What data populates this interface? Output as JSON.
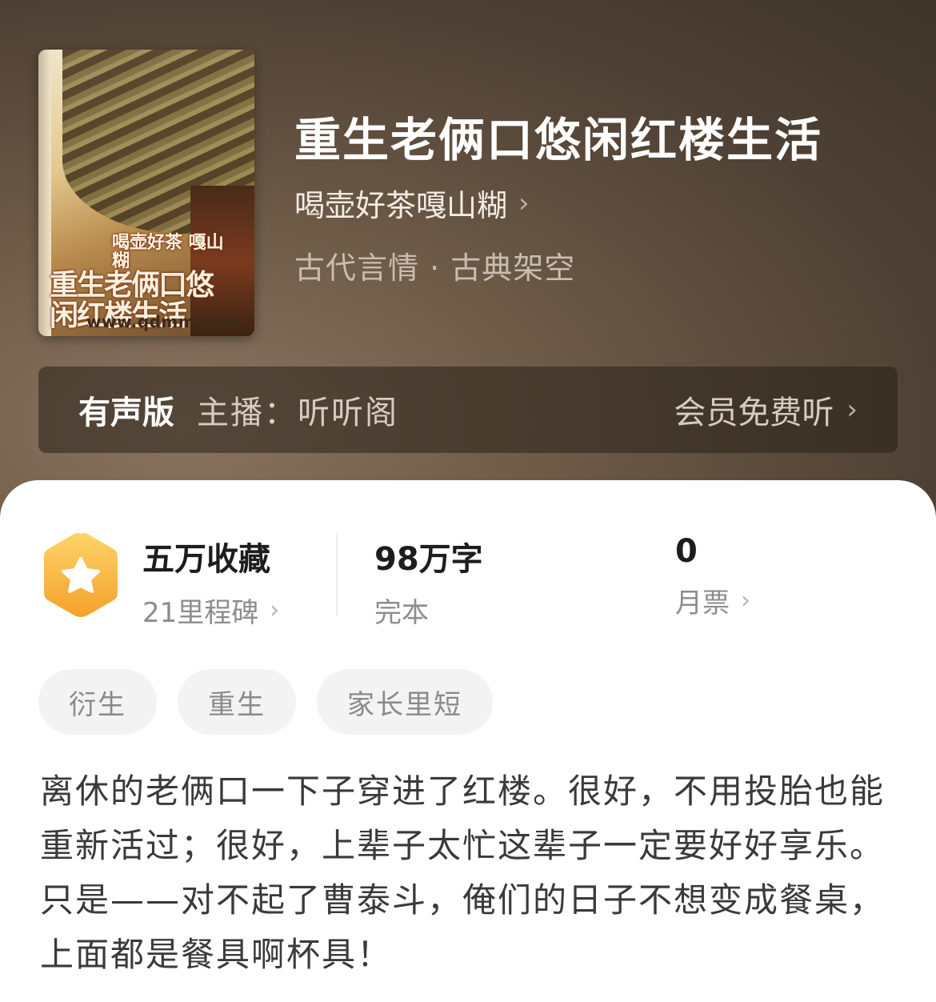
{
  "book": {
    "title": "重生老俩口悠闲红楼生活",
    "author": "喝壶好茶嘎山糊",
    "genre": "古代言情 · 古典架空",
    "cover": {
      "sub_text": "喝壶好茶 嘎山糊",
      "main_text": "重生老俩口悠闲红楼生活",
      "url_text": "www.qdmm.com"
    }
  },
  "audio": {
    "label": "有声版",
    "host": "主播：听听阁",
    "action": "会员免费听"
  },
  "stats": {
    "collect": {
      "value": "五万收藏",
      "sub": "21里程碑"
    },
    "words": {
      "value": "98万字",
      "sub": "完本"
    },
    "tickets": {
      "value": "0",
      "sub": "月票"
    }
  },
  "tags": [
    "衍生",
    "重生",
    "家长里短"
  ],
  "description": "离休的老俩口一下子穿进了红楼。很好，不用投胎也能重新活过；很好，上辈子太忙这辈子一定要好好享乐。只是——对不起了曹泰斗，俺们的日子不想变成餐桌，上面都是餐具啊杯具！",
  "icons": {
    "chevron": "chevron-right-icon",
    "badge": "star-hexagon-icon"
  },
  "colors": {
    "badge_gradient_top": "#ffd36a",
    "badge_gradient_bottom": "#f4a12a"
  }
}
